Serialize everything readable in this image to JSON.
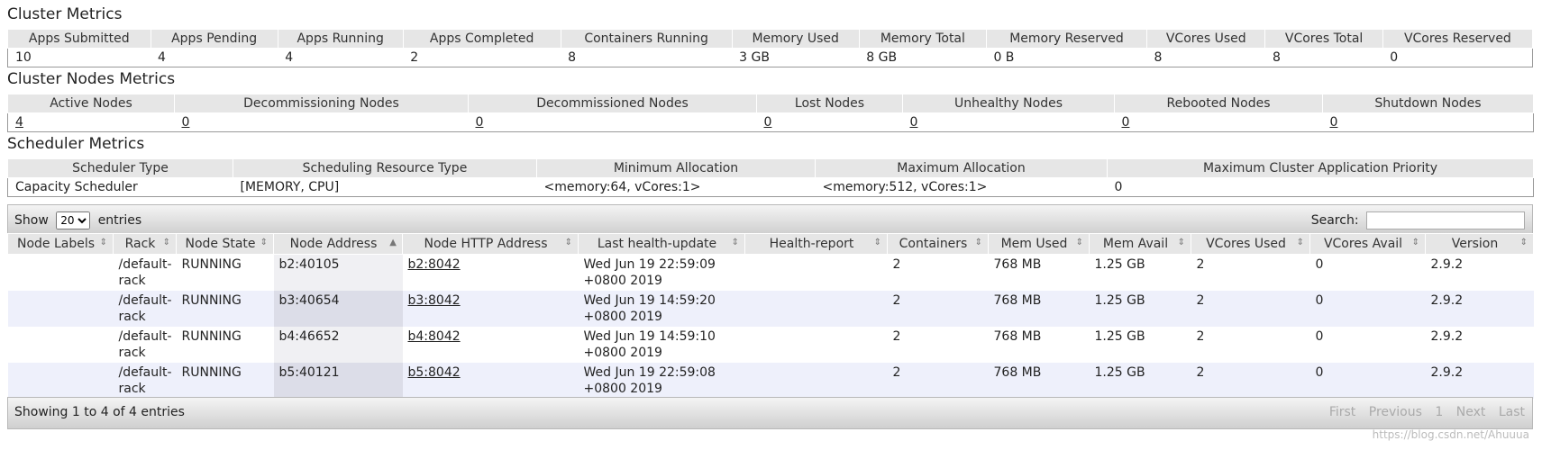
{
  "cluster_metrics": {
    "title": "Cluster Metrics",
    "headers": [
      "Apps Submitted",
      "Apps Pending",
      "Apps Running",
      "Apps Completed",
      "Containers Running",
      "Memory Used",
      "Memory Total",
      "Memory Reserved",
      "VCores Used",
      "VCores Total",
      "VCores Reserved"
    ],
    "values": [
      "10",
      "4",
      "4",
      "2",
      "8",
      "3 GB",
      "8 GB",
      "0 B",
      "8",
      "8",
      "0"
    ]
  },
  "nodes_metrics": {
    "title": "Cluster Nodes Metrics",
    "headers": [
      "Active Nodes",
      "Decommissioning Nodes",
      "Decommissioned Nodes",
      "Lost Nodes",
      "Unhealthy Nodes",
      "Rebooted Nodes",
      "Shutdown Nodes"
    ],
    "values": [
      "4",
      "0",
      "0",
      "0",
      "0",
      "0",
      "0"
    ]
  },
  "scheduler_metrics": {
    "title": "Scheduler Metrics",
    "headers": [
      "Scheduler Type",
      "Scheduling Resource Type",
      "Minimum Allocation",
      "Maximum Allocation",
      "Maximum Cluster Application Priority"
    ],
    "values": [
      "Capacity Scheduler",
      "[MEMORY, CPU]",
      "<memory:64, vCores:1>",
      "<memory:512, vCores:1>",
      "0"
    ]
  },
  "toolbar": {
    "show_label": "Show",
    "page_size": "20",
    "entries_label": "entries",
    "search_label": "Search:"
  },
  "nodes_table": {
    "headers": [
      "Node Labels",
      "Rack",
      "Node State",
      "Node Address",
      "Node HTTP Address",
      "Last health-update",
      "Health-report",
      "Containers",
      "Mem Used",
      "Mem Avail",
      "VCores Used",
      "VCores Avail",
      "Version"
    ],
    "rows": [
      {
        "labels": "",
        "rack": "/default-rack",
        "state": "RUNNING",
        "address": "b2:40105",
        "http": "b2:8042",
        "health_update": "Wed Jun 19 22:59:09 +0800 2019",
        "health_report": "",
        "containers": "2",
        "mem_used": "768 MB",
        "mem_avail": "1.25 GB",
        "vcores_used": "2",
        "vcores_avail": "0",
        "version": "2.9.2"
      },
      {
        "labels": "",
        "rack": "/default-rack",
        "state": "RUNNING",
        "address": "b3:40654",
        "http": "b3:8042",
        "health_update": "Wed Jun 19 14:59:20 +0800 2019",
        "health_report": "",
        "containers": "2",
        "mem_used": "768 MB",
        "mem_avail": "1.25 GB",
        "vcores_used": "2",
        "vcores_avail": "0",
        "version": "2.9.2"
      },
      {
        "labels": "",
        "rack": "/default-rack",
        "state": "RUNNING",
        "address": "b4:46652",
        "http": "b4:8042",
        "health_update": "Wed Jun 19 14:59:10 +0800 2019",
        "health_report": "",
        "containers": "2",
        "mem_used": "768 MB",
        "mem_avail": "1.25 GB",
        "vcores_used": "2",
        "vcores_avail": "0",
        "version": "2.9.2"
      },
      {
        "labels": "",
        "rack": "/default-rack",
        "state": "RUNNING",
        "address": "b5:40121",
        "http": "b5:8042",
        "health_update": "Wed Jun 19 22:59:08 +0800 2019",
        "health_report": "",
        "containers": "2",
        "mem_used": "768 MB",
        "mem_avail": "1.25 GB",
        "vcores_used": "2",
        "vcores_avail": "0",
        "version": "2.9.2"
      }
    ]
  },
  "footer": {
    "info": "Showing 1 to 4 of 4 entries",
    "first": "First",
    "previous": "Previous",
    "page": "1",
    "next": "Next",
    "last": "Last"
  },
  "watermark": "https://blog.csdn.net/Ahuuua"
}
